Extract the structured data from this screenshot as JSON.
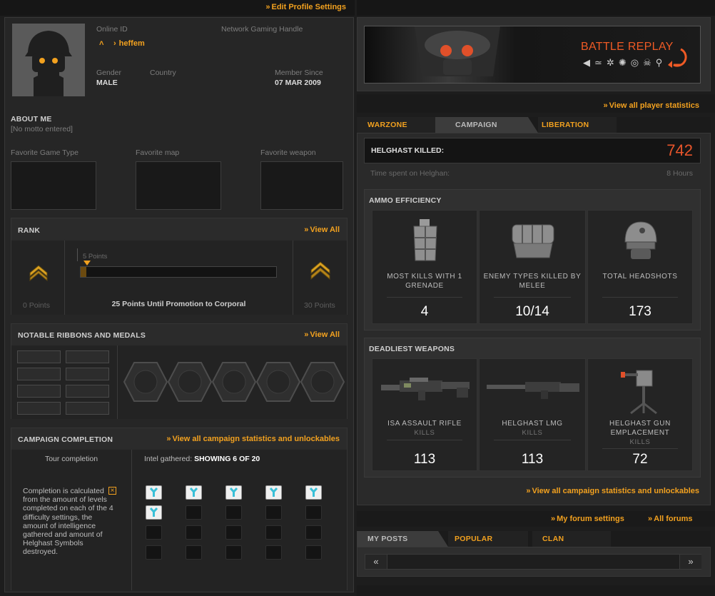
{
  "profile": {
    "edit_link": "Edit Profile Settings",
    "online_id_label": "Online ID",
    "online_id": "heffem",
    "handle_label": "Network Gaming Handle",
    "gender_label": "Gender",
    "gender": "MALE",
    "country_label": "Country",
    "member_since_label": "Member Since",
    "member_since": "07 MAR 2009",
    "about_me_title": "ABOUT ME",
    "motto": "[No motto entered]",
    "fav_game_type_label": "Favorite Game Type",
    "fav_map_label": "Favorite map",
    "fav_weapon_label": "Favorite weapon"
  },
  "rank": {
    "title": "RANK",
    "view_all": "View All",
    "left_points": "0 Points",
    "bar_label": "5 Points",
    "progress": 0.03,
    "right_points": "30 Points",
    "promotion_text": "25 Points Until Promotion to Corporal"
  },
  "ribbons": {
    "title": "NOTABLE RIBBONS AND MEDALS",
    "view_all": "View All"
  },
  "campaign": {
    "title": "CAMPAIGN COMPLETION",
    "view_all": "View all campaign statistics and unlockables",
    "tour_label": "Tour completion",
    "intel_label": "Intel gathered:",
    "intel_value": "SHOWING 6 OF 20",
    "intel_found": 6,
    "intel_total": 20,
    "info_text": "Completion is calculated from the amount of  levels completed on each of the 4 difficulty settings, the amount of intelligence gathered and amount of Helghast Symbols destroyed."
  },
  "battle_replay": {
    "title": "BATTLE REPLAY",
    "view_stats": "View all player statistics"
  },
  "stats_tabs": [
    "WARZONE",
    "CAMPAIGN",
    "LIBERATION"
  ],
  "stats": {
    "helghast_killed_label": "HELGHAST KILLED:",
    "helghast_killed": "742",
    "time_label": "Time spent on Helghan:",
    "time_value": "8 Hours",
    "ammo_title": "AMMO EFFICIENCY",
    "ammo": [
      {
        "caption": "MOST KILLS WITH 1 GRENADE",
        "value": "4",
        "icon": "grenade-icon"
      },
      {
        "caption": "ENEMY TYPES KILLED BY MELEE",
        "value": "10/14",
        "icon": "fist-icon"
      },
      {
        "caption": "TOTAL HEADSHOTS",
        "value": "173",
        "icon": "helmet-icon"
      }
    ],
    "weapons_title": "DEADLIEST WEAPONS",
    "weapons": [
      {
        "caption": "ISA ASSAULT RIFLE",
        "sub": "KILLS",
        "value": "113",
        "icon": "assault-rifle-icon"
      },
      {
        "caption": "HELGHAST LMG",
        "sub": "KILLS",
        "value": "113",
        "icon": "lmg-icon"
      },
      {
        "caption": "HELGHAST GUN EMPLACEMENT",
        "sub": "KILLS",
        "value": "72",
        "icon": "gun-emplacement-icon"
      }
    ],
    "view_campaign": "View all campaign statistics and unlockables"
  },
  "forum": {
    "my_settings": "My forum settings",
    "all_forums": "All forums",
    "tabs": [
      "MY POSTS",
      "POPULAR",
      "CLAN"
    ],
    "prev": "«",
    "next": "»"
  },
  "colors": {
    "accent": "#f2a11f",
    "kills": "#e8552b",
    "background": "#1d1d1d"
  }
}
